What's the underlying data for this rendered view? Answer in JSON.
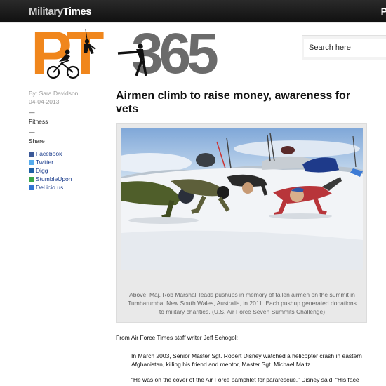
{
  "site": {
    "brand_part1": "Military",
    "brand_part2": "Times",
    "topbar_right": "P"
  },
  "logo": {
    "letters": "PT",
    "number": "365"
  },
  "search": {
    "placeholder": "Search here"
  },
  "article": {
    "author": "By:  Sara Davidson",
    "date": "04-04-2013",
    "separator": "—",
    "category": "Fitness",
    "share_label": "Share",
    "share_links": [
      {
        "label": "Facebook",
        "color": "#3b5998"
      },
      {
        "label": "Twitter",
        "color": "#55acee"
      },
      {
        "label": "Digg",
        "color": "#1d5fa5"
      },
      {
        "label": "StumbleUpon",
        "color": "#3aa648"
      },
      {
        "label": "Del.icio.us",
        "color": "#3274d2"
      }
    ],
    "title": "Airmen climb to raise money, awareness for vets",
    "caption": "Above, Maj. Rob Marshall leads pushups in memory of fallen airmen on the summit in Tumbarumba, New South Wales, Australia, in 2011. Each pushup generated donations to military charities. (U.S. Air Force Seven Summits Challenge)",
    "paragraphs": [
      "From Air Force Times staff writer Jeff Schogol:",
      "In March 2003, Senior Master Sgt. Robert Disney watched a helicopter crash in eastern Afghanistan, killing his friend and mentor, Master Sgt. Michael Maltz.",
      "“He was on the cover of the Air Force pamphlet for pararescue,” Disney said. “His face"
    ]
  }
}
